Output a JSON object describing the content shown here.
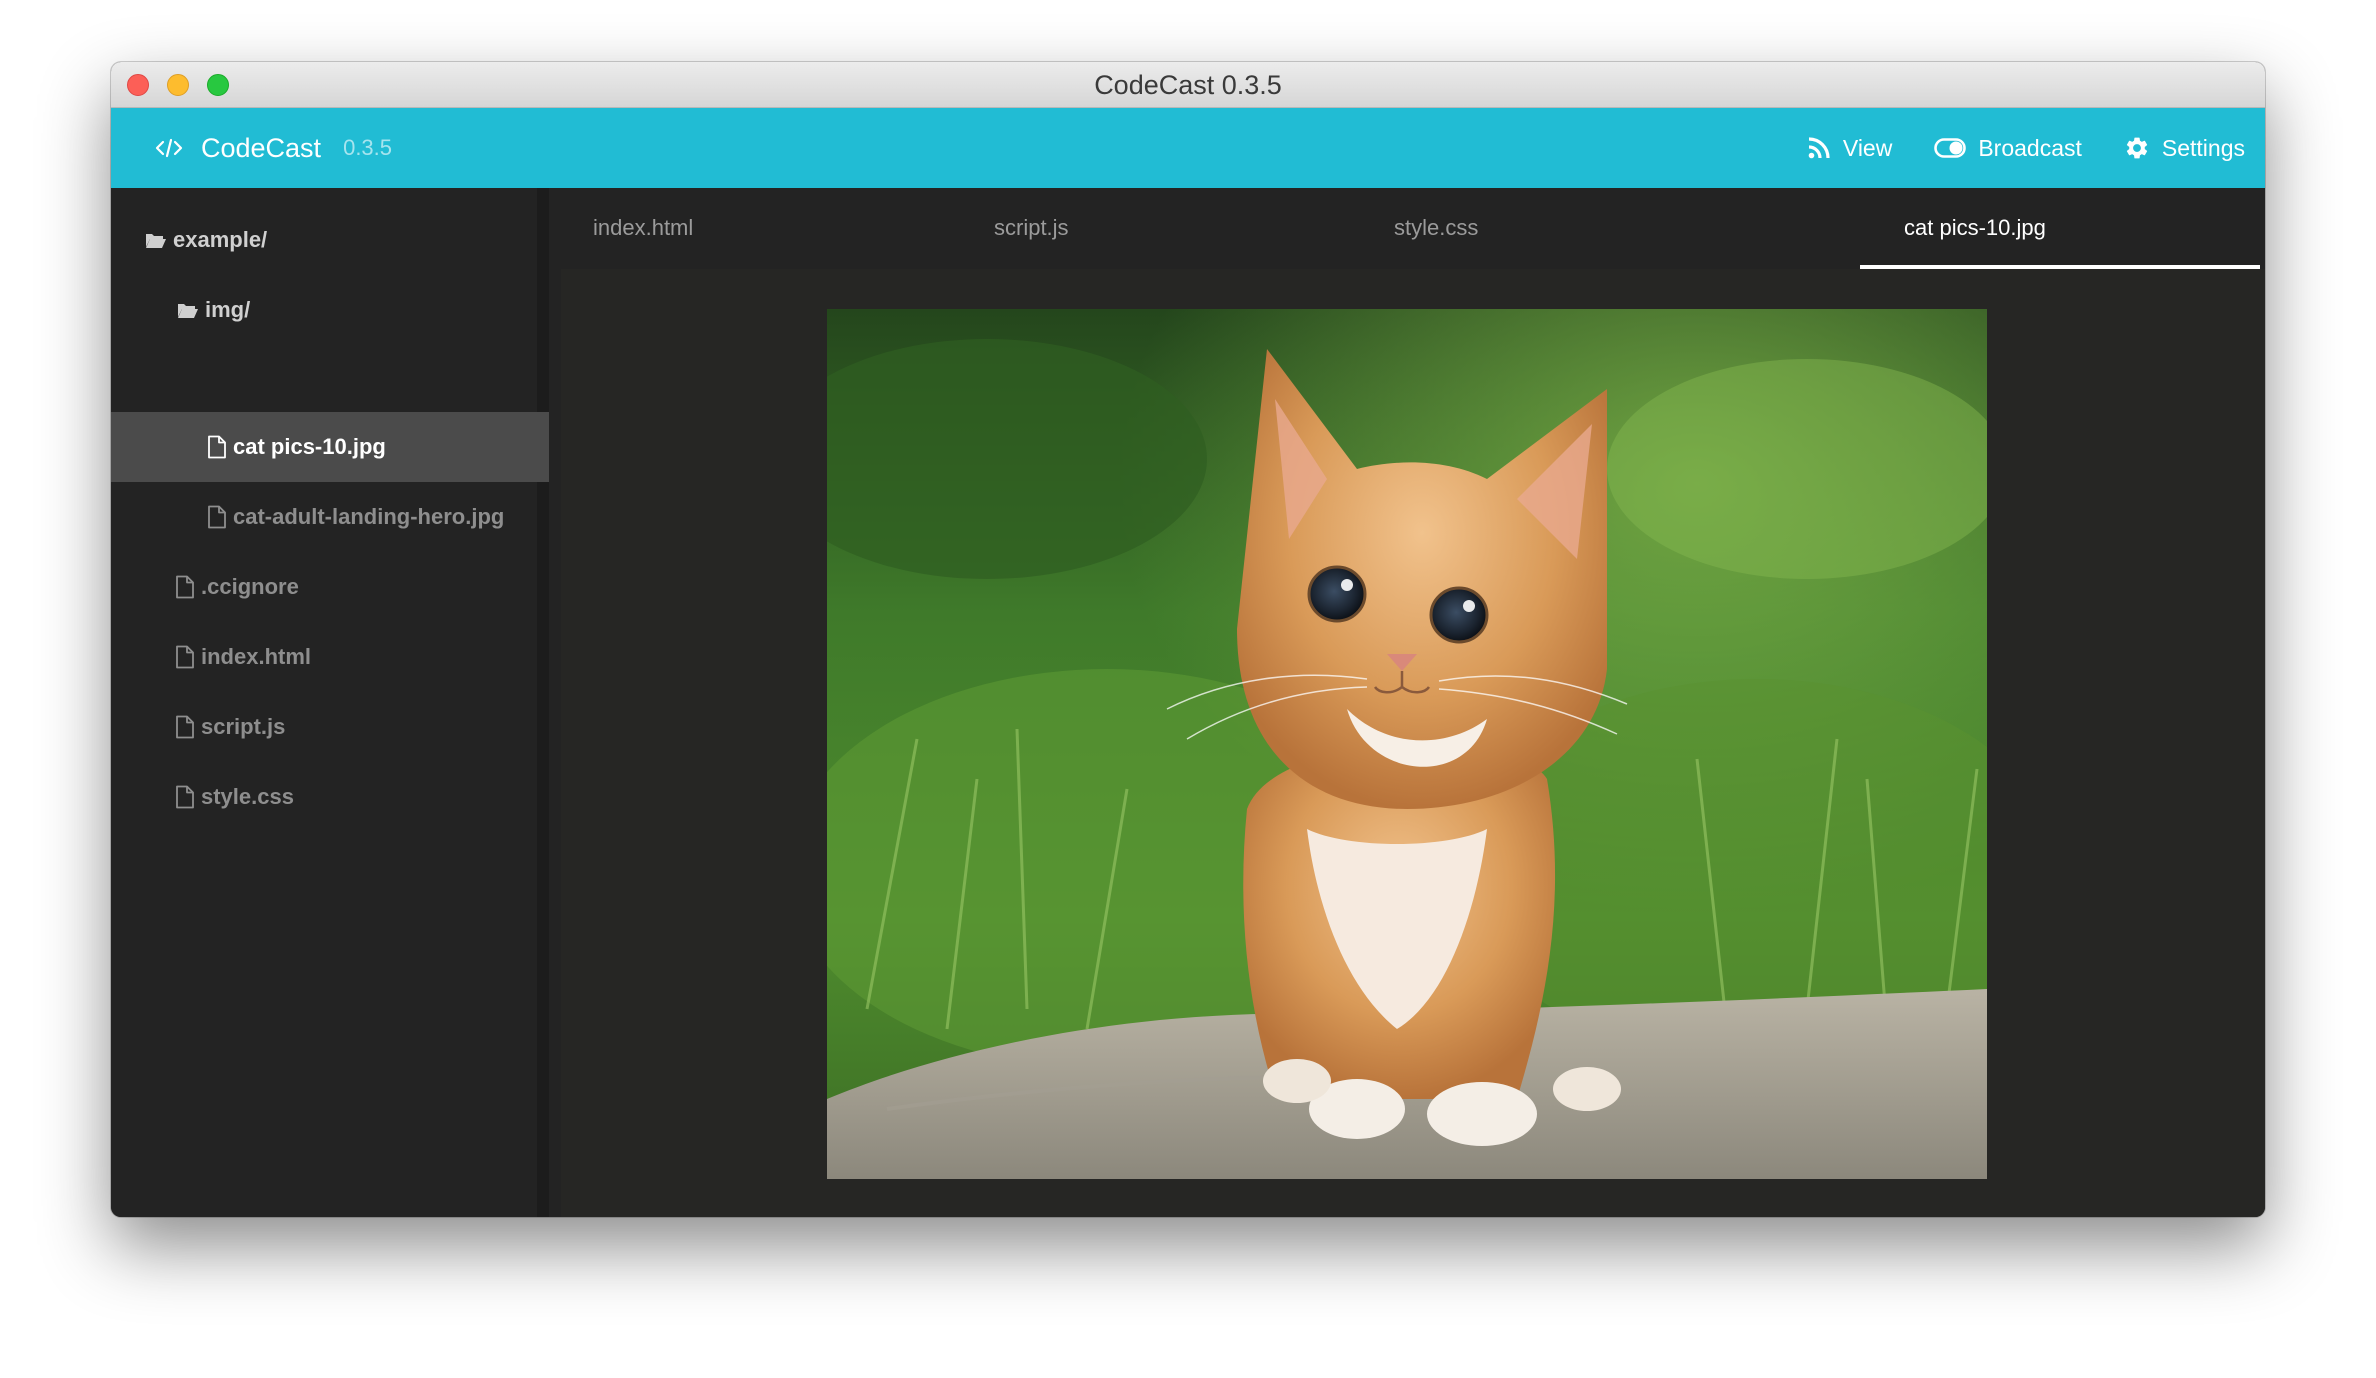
{
  "window": {
    "title": "CodeCast 0.3.5"
  },
  "appbar": {
    "brand_name": "CodeCast",
    "brand_version": "0.3.5",
    "accent_color": "#21bcd4",
    "nav": [
      {
        "label": "View",
        "icon": "rss-icon"
      },
      {
        "label": "Broadcast",
        "icon": "toggle-icon"
      },
      {
        "label": "Settings",
        "icon": "gear-icon"
      }
    ]
  },
  "sidebar": {
    "items": [
      {
        "label": "example/",
        "type": "folder"
      },
      {
        "label": "img/",
        "type": "folder"
      },
      {
        "label": "cat pics-10.jpg",
        "type": "file",
        "active": true
      },
      {
        "label": "cat-adult-landing-hero.jpg",
        "type": "file"
      },
      {
        "label": ".ccignore",
        "type": "file"
      },
      {
        "label": "index.html",
        "type": "file"
      },
      {
        "label": "script.js",
        "type": "file"
      },
      {
        "label": "style.css",
        "type": "file"
      }
    ]
  },
  "tabs": [
    {
      "label": "index.html"
    },
    {
      "label": "script.js"
    },
    {
      "label": "style.css"
    },
    {
      "label": "cat pics-10.jpg",
      "active": true
    }
  ],
  "viewer": {
    "image_subject": "orange kitten sitting on a rock in grass"
  }
}
